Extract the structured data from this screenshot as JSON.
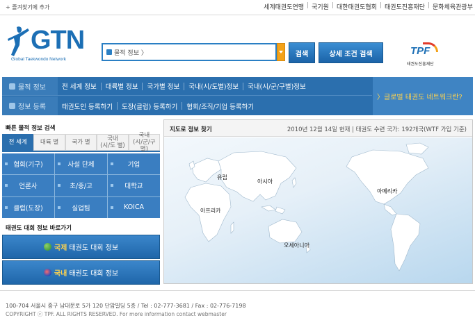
{
  "topbar": {
    "bookmark": "+ 즐겨찾기에 추가",
    "links": [
      "세계태권도연맹",
      "국기원",
      "대한태권도협회",
      "태권도진흥재단",
      "문화체육관광부"
    ]
  },
  "header": {
    "logo_text": "GTN",
    "logo_sub": "Global Taekwondo Network",
    "search_placeholder": "물적 정보 〉",
    "search_button": "검색",
    "detail_button": "상세 조건 검색",
    "partner_logo": "TPF",
    "partner_sub": "태권도진흥재단"
  },
  "nav": {
    "row1_head": "물적 정보",
    "row1_items": [
      "전 세계 정보",
      "대륙별 정보",
      "국가별 정보",
      "국내(시/도별)정보",
      "국내(시/군/구별)정보"
    ],
    "row2_head": "정보 등록",
    "row2_items": [
      "태권도인 등록하기",
      "도장(클럽) 등록하기",
      "협회/조직/기업 등록하기"
    ],
    "right_link": "〉글로벌 태권도 네트워크란?"
  },
  "quick": {
    "title": "빠른 물적 정보 검색",
    "tabs": [
      "전 세계",
      "대륙 별",
      "국가 별",
      "국내\n(시/도 별)",
      "국내\n(시/군/구 별)"
    ],
    "cells": [
      "협회(기구)",
      "사설 단체",
      "기업",
      "언론사",
      "초/중/고",
      "대학교",
      "클럽(도장)",
      "실업팀",
      "KOICA"
    ]
  },
  "tournaments": {
    "title": "태권도 대회 정보 바로가기",
    "intl_hl": "국제",
    "intl_rest": "태권도 대회 정보",
    "dom_hl": "국내",
    "dom_rest": "태권도 대회 정보"
  },
  "map": {
    "title": "지도로 정보 찾기",
    "date": "2010년 12월 14일 현재 | 태권도 수련 국가: 192개국(WTF 가입 기준)",
    "regions": [
      "유럽",
      "아시아",
      "아메리카",
      "아프리카",
      "오세아니아"
    ]
  },
  "footer": {
    "address": "100-704 서울시 중구 남대문로 5가 120 단암빌딩 5층  /  Tel : 02-777-3681  /  Fax : 02-776-7198",
    "copyright": "COPYRIGHT ⓒ TPF. ALL RIGHTS RESERVED. For more information contact webmaster"
  }
}
